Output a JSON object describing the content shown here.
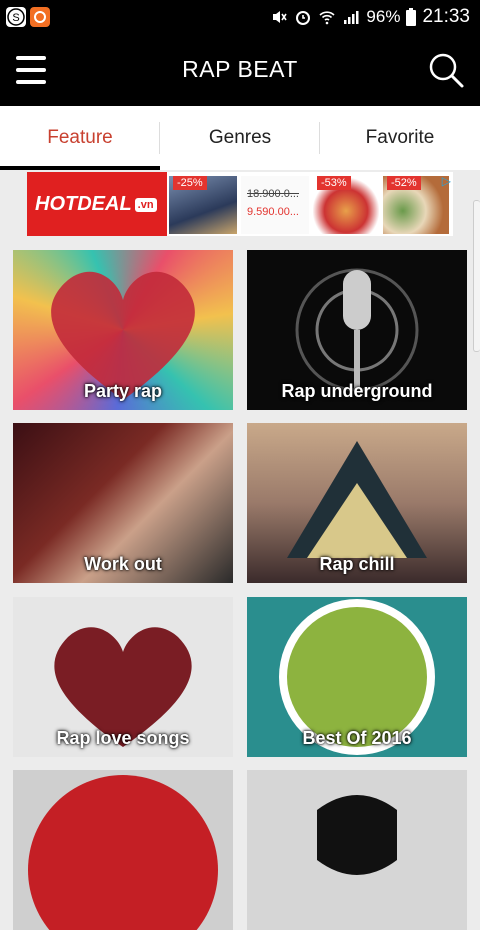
{
  "status_bar": {
    "battery": "96%",
    "time": "21:33"
  },
  "app_bar": {
    "title": "RAP BEAT"
  },
  "tabs": [
    {
      "label": "Feature",
      "active": true
    },
    {
      "label": "Genres",
      "active": false
    },
    {
      "label": "Favorite",
      "active": false
    }
  ],
  "ad": {
    "brand": "HOTDEAL",
    "brand_suffix": ".vn",
    "deals": [
      {
        "discount": "-25%",
        "price_old": "",
        "price_new": ""
      },
      {
        "discount": "",
        "price_old": "18.900.0...",
        "price_new": "9.590.00..."
      },
      {
        "discount": "-53%",
        "price_old": "",
        "price_new": ""
      },
      {
        "discount": "-52%",
        "price_old": "",
        "price_new": ""
      }
    ]
  },
  "cards": [
    {
      "label": "Party rap"
    },
    {
      "label": "Rap underground"
    },
    {
      "label": "Work out"
    },
    {
      "label": "Rap chill"
    },
    {
      "label": "Rap love songs"
    },
    {
      "label": "Best Of 2016"
    },
    {
      "label": ""
    },
    {
      "label": ""
    }
  ],
  "colors": {
    "accent": "#c8402f",
    "bar": "#000000",
    "background": "#ececec"
  }
}
